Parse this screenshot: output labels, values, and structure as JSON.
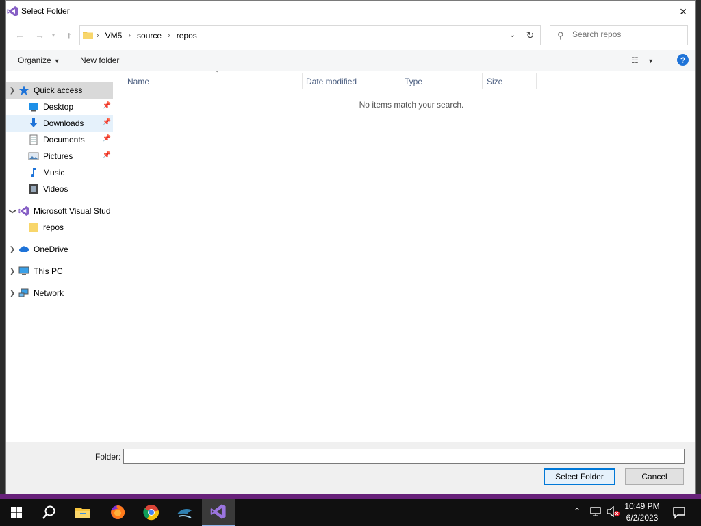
{
  "dialog": {
    "title": "Select Folder",
    "close_glyph": "×"
  },
  "address": {
    "crumbs": [
      "VM5",
      "source",
      "repos"
    ],
    "separator": "›"
  },
  "search": {
    "placeholder": "Search repos"
  },
  "toolbar": {
    "organize_label": "Organize",
    "new_folder_label": "New folder",
    "help_glyph": "?"
  },
  "nav": {
    "quick_access": "Quick access",
    "items": [
      {
        "label": "Desktop",
        "icon": "desktop-icon",
        "pinned": true
      },
      {
        "label": "Downloads",
        "icon": "download-arrow-icon",
        "pinned": true
      },
      {
        "label": "Documents",
        "icon": "document-icon",
        "pinned": true
      },
      {
        "label": "Pictures",
        "icon": "pictures-icon",
        "pinned": true
      },
      {
        "label": "Music",
        "icon": "music-note-icon",
        "pinned": false
      },
      {
        "label": "Videos",
        "icon": "film-icon",
        "pinned": false
      }
    ],
    "vs_group": "Microsoft Visual Stud",
    "vs_child": "repos",
    "onedrive": "OneDrive",
    "this_pc": "This PC",
    "network": "Network"
  },
  "list": {
    "columns": [
      "Name",
      "Date modified",
      "Type",
      "Size"
    ],
    "empty_message": "No items match your search."
  },
  "bottom": {
    "folder_label": "Folder:",
    "folder_value": "",
    "select_label": "Select Folder",
    "cancel_label": "Cancel"
  },
  "taskbar": {
    "time": "10:49 PM",
    "date": "6/2/2023"
  },
  "colors": {
    "accent": "#0078d7",
    "vs_purple": "#68217a",
    "help_blue": "#1e73d8"
  }
}
